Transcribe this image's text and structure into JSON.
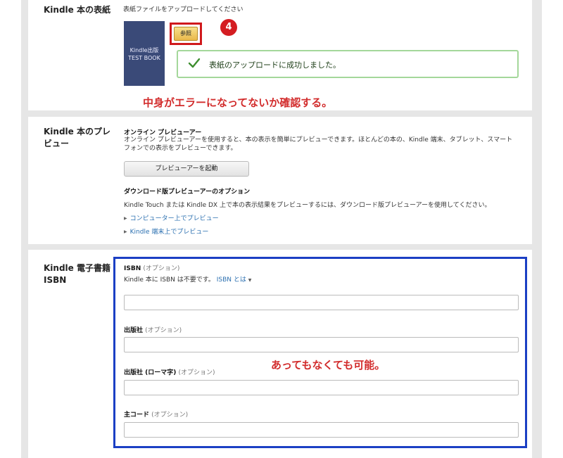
{
  "cover": {
    "title": "Kindle 本の表紙",
    "instruction": "表紙ファイルをアップロードしてください",
    "book_text": "Kindle出版\nTEST BOOK",
    "browse_label": "参照",
    "step_number": "4",
    "success_message": "表紙のアップロードに成功しました。",
    "annotation": "中身がエラーになってないか確認する。"
  },
  "preview": {
    "title": "Kindle 本のプレビュー",
    "online_label": "オンライン プレビューアー",
    "online_desc": "オンライン プレビューアーを使用すると、本の表示を簡単にプレビューできます。ほとんどの本の、Kindle 端末、タブレット、スマートフォンでの表示をプレビューできます。",
    "launch_button": "プレビューアーを起動",
    "download_label": "ダウンロード版プレビューアーのオプション",
    "download_desc": "Kindle Touch または Kindle DX 上で本の表示結果をプレビューするには、ダウンロード版プレビューアーを使用してください。",
    "link_computer": "コンピューター上でプレビュー",
    "link_device": "Kindle 端末上でプレビュー"
  },
  "isbn": {
    "title": "Kindle 電子書籍 ISBN",
    "isbn_label": "ISBN",
    "optional": "(オプション)",
    "isbn_note": "Kindle 本に ISBN は不要です。",
    "isbn_link": "ISBN とは",
    "publisher_label": "出版社",
    "publisher_roman_label": "出版社 (ローマ字)",
    "main_code_label": "主コード",
    "annotation": "あってもなくても可能。"
  },
  "colors": {
    "annotation_red": "#d22c2c",
    "highlight_blue": "#1b3fc4",
    "success_green": "#a4d79a"
  }
}
